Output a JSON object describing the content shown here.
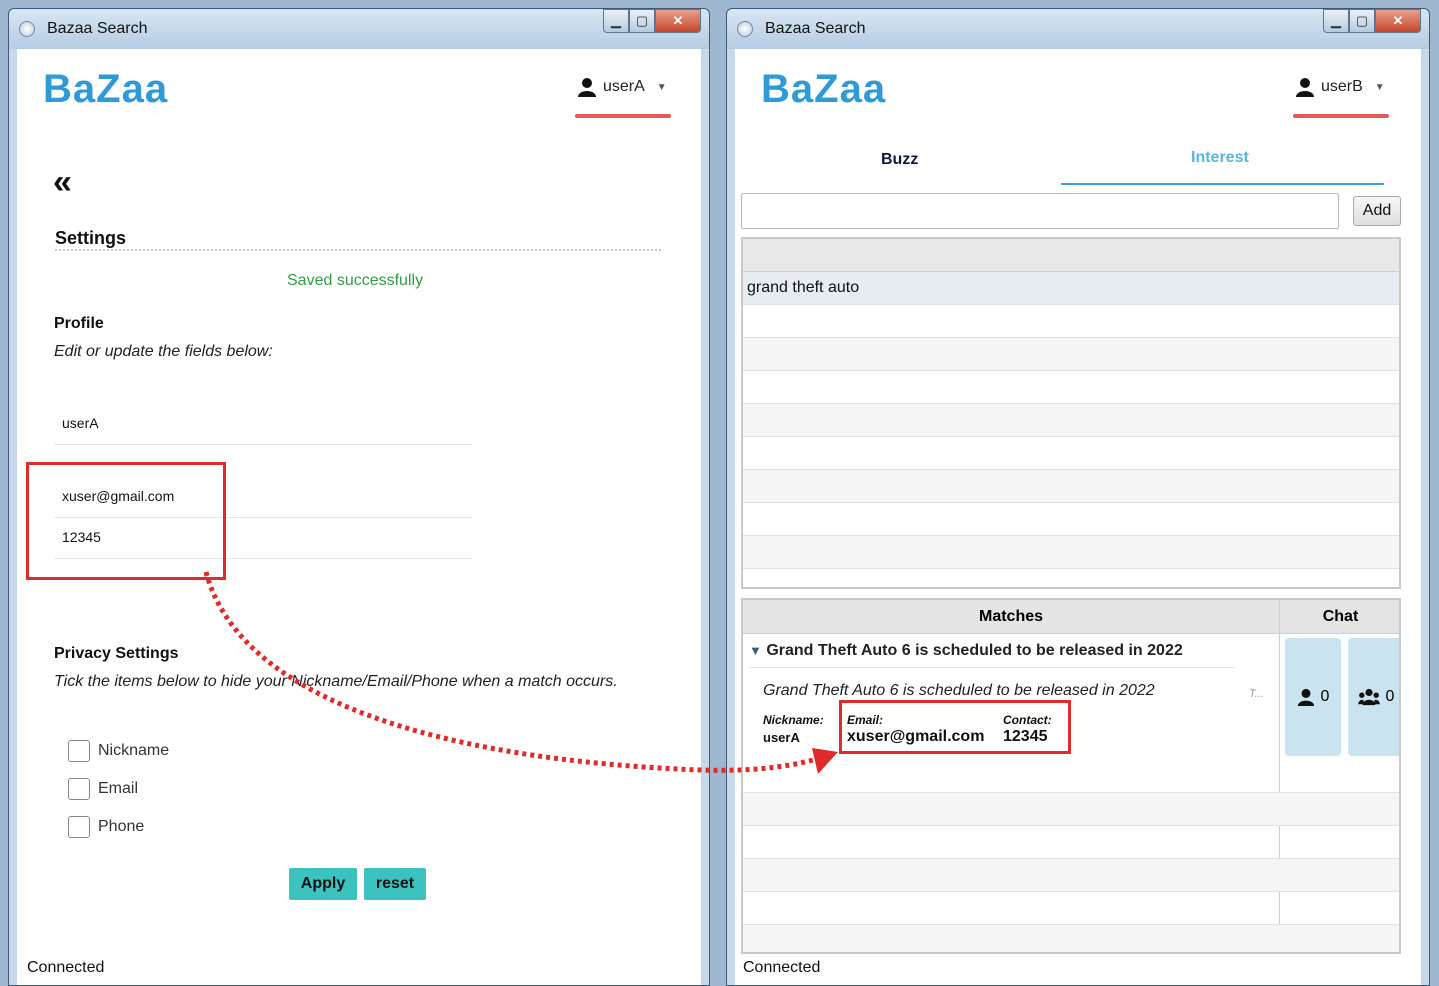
{
  "windows": {
    "left": {
      "title": "Bazaa Search",
      "logo": "BaZaa",
      "user": "userA",
      "back_label": "«",
      "settings_title": "Settings",
      "saved_message": "Saved successfully",
      "profile": {
        "title": "Profile",
        "description": "Edit or update the fields below:",
        "nickname": "userA",
        "email": "xuser@gmail.com",
        "phone": "12345"
      },
      "privacy": {
        "title": "Privacy Settings",
        "description": "Tick the items below to hide your Nickname/Email/Phone when a match occurs.",
        "options": [
          "Nickname",
          "Email",
          "Phone"
        ]
      },
      "buttons": {
        "apply": "Apply",
        "reset": "reset"
      },
      "status": "Connected"
    },
    "right": {
      "title": "Bazaa Search",
      "logo": "BaZaa",
      "user": "userB",
      "tabs": [
        "Buzz",
        "Interest"
      ],
      "add_label": "Add",
      "interests": [
        "grand theft auto"
      ],
      "matches": {
        "header": "Matches",
        "chat_header": "Chat",
        "group": "Grand Theft Auto 6 is scheduled to be released in 2022",
        "description": "Grand Theft Auto 6 is scheduled to be released in 2022",
        "ellipsis": "T...",
        "nickname_label": "Nickname:",
        "nickname": "userA",
        "email_label": "Email:",
        "email": "xuser@gmail.com",
        "contact_label": "Contact:",
        "contact": "12345",
        "chat_person_count": "0",
        "chat_group_count": "0"
      },
      "status": "Connected"
    }
  },
  "colors": {
    "brand": "#2e9bd6",
    "accent_teal": "#3cc3c0",
    "success": "#2ea043",
    "annotation": "#e02b2b",
    "underline": "#e45858"
  }
}
